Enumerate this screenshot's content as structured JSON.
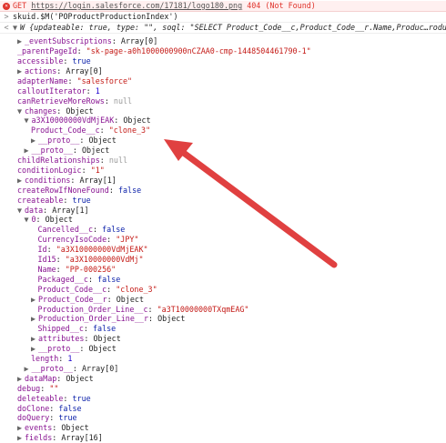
{
  "error": {
    "method": "GET",
    "url": "https://login.salesforce.com/17181/logo180.png",
    "status": "404 (Not Found)"
  },
  "command": "skuid.$M('POProductProductionIndex')",
  "summary": "W {updateable: true, type: \"\", soql: \"SELECT Product_Code__c,Product_Code__r.Name,Produc…roduct",
  "lines": [
    {
      "indent": 1,
      "toggle": "right",
      "key": "_eventSubscriptions",
      "vt": "plain",
      "value": "Array[0]"
    },
    {
      "indent": 1,
      "toggle": "",
      "key": "_parentPageId",
      "vt": "string",
      "value": "\"sk-page-a0h1000000900nCZAA0-cmp-1448504461790-1\""
    },
    {
      "indent": 1,
      "toggle": "",
      "key": "accessible",
      "vt": "keyword",
      "value": "true"
    },
    {
      "indent": 1,
      "toggle": "right",
      "key": "actions",
      "vt": "plain",
      "value": "Array[0]"
    },
    {
      "indent": 1,
      "toggle": "",
      "key": "adapterName",
      "vt": "string",
      "value": "\"salesforce\""
    },
    {
      "indent": 1,
      "toggle": "",
      "key": "calloutIterator",
      "vt": "number",
      "value": "1"
    },
    {
      "indent": 1,
      "toggle": "",
      "key": "canRetrieveMoreRows",
      "vt": "null",
      "value": "null"
    },
    {
      "indent": 1,
      "toggle": "down",
      "key": "changes",
      "vt": "plain",
      "value": "Object"
    },
    {
      "indent": 2,
      "toggle": "down",
      "key": "a3X10000000VdMjEAK",
      "vt": "plain",
      "value": "Object"
    },
    {
      "indent": 3,
      "toggle": "",
      "key": "Product_Code__c",
      "vt": "string",
      "value": "\"clone_3\""
    },
    {
      "indent": 3,
      "toggle": "right",
      "key": "__proto__",
      "vt": "plain",
      "value": "Object"
    },
    {
      "indent": 2,
      "toggle": "right",
      "key": "__proto__",
      "vt": "plain",
      "value": "Object"
    },
    {
      "indent": 1,
      "toggle": "",
      "key": "childRelationships",
      "vt": "null",
      "value": "null"
    },
    {
      "indent": 1,
      "toggle": "",
      "key": "conditionLogic",
      "vt": "string",
      "value": "\"1\""
    },
    {
      "indent": 1,
      "toggle": "right",
      "key": "conditions",
      "vt": "plain",
      "value": "Array[1]"
    },
    {
      "indent": 1,
      "toggle": "",
      "key": "createRowIfNoneFound",
      "vt": "keyword",
      "value": "false"
    },
    {
      "indent": 1,
      "toggle": "",
      "key": "createable",
      "vt": "keyword",
      "value": "true"
    },
    {
      "indent": 1,
      "toggle": "down",
      "key": "data",
      "vt": "plain",
      "value": "Array[1]"
    },
    {
      "indent": 2,
      "toggle": "down",
      "key": "0",
      "vt": "plain",
      "value": "Object"
    },
    {
      "indent": 4,
      "toggle": "",
      "key": "Cancelled__c",
      "vt": "keyword",
      "value": "false"
    },
    {
      "indent": 4,
      "toggle": "",
      "key": "CurrencyIsoCode",
      "vt": "string",
      "value": "\"JPY\""
    },
    {
      "indent": 4,
      "toggle": "",
      "key": "Id",
      "vt": "string",
      "value": "\"a3X10000000VdMjEAK\""
    },
    {
      "indent": 4,
      "toggle": "",
      "key": "Id15",
      "vt": "string",
      "value": "\"a3X10000000VdMj\""
    },
    {
      "indent": 4,
      "toggle": "",
      "key": "Name",
      "vt": "string",
      "value": "\"PP-000256\""
    },
    {
      "indent": 4,
      "toggle": "",
      "key": "Packaged__c",
      "vt": "keyword",
      "value": "false"
    },
    {
      "indent": 4,
      "toggle": "",
      "key": "Product_Code__c",
      "vt": "string",
      "value": "\"clone_3\""
    },
    {
      "indent": 3,
      "toggle": "right",
      "key": "Product_Code__r",
      "vt": "plain",
      "value": "Object"
    },
    {
      "indent": 4,
      "toggle": "",
      "key": "Production_Order_Line__c",
      "vt": "string",
      "value": "\"a3T10000000TXqmEAG\""
    },
    {
      "indent": 3,
      "toggle": "right",
      "key": "Production_Order_Line__r",
      "vt": "plain",
      "value": "Object"
    },
    {
      "indent": 4,
      "toggle": "",
      "key": "Shipped__c",
      "vt": "keyword",
      "value": "false"
    },
    {
      "indent": 3,
      "toggle": "right",
      "key": "attributes",
      "vt": "plain",
      "value": "Object"
    },
    {
      "indent": 3,
      "toggle": "right",
      "key": "__proto__",
      "vt": "plain",
      "value": "Object"
    },
    {
      "indent": 3,
      "toggle": "",
      "key": "length",
      "vt": "number",
      "value": "1"
    },
    {
      "indent": 2,
      "toggle": "right",
      "key": "__proto__",
      "vt": "plain",
      "value": "Array[0]"
    },
    {
      "indent": 1,
      "toggle": "right",
      "key": "dataMap",
      "vt": "plain",
      "value": "Object"
    },
    {
      "indent": 1,
      "toggle": "",
      "key": "debug",
      "vt": "string",
      "value": "\"\""
    },
    {
      "indent": 1,
      "toggle": "",
      "key": "deleteable",
      "vt": "keyword",
      "value": "true"
    },
    {
      "indent": 1,
      "toggle": "",
      "key": "doClone",
      "vt": "keyword",
      "value": "false"
    },
    {
      "indent": 1,
      "toggle": "",
      "key": "doQuery",
      "vt": "keyword",
      "value": "true"
    },
    {
      "indent": 1,
      "toggle": "right",
      "key": "events",
      "vt": "plain",
      "value": "Object"
    },
    {
      "indent": 1,
      "toggle": "right",
      "key": "fields",
      "vt": "plain",
      "value": "Array[16]"
    }
  ],
  "colors": {
    "error": "#e0342c",
    "key": "#881391",
    "string": "#c41a16",
    "number": "#1c00cf",
    "keyword": "#0d22aa",
    "arrow": "#e04040"
  },
  "icons": {
    "error": "error-icon",
    "prompt": "prompt-chevron-icon",
    "output": "output-chevron-icon",
    "expand": "disclosure-triangle-icon"
  }
}
